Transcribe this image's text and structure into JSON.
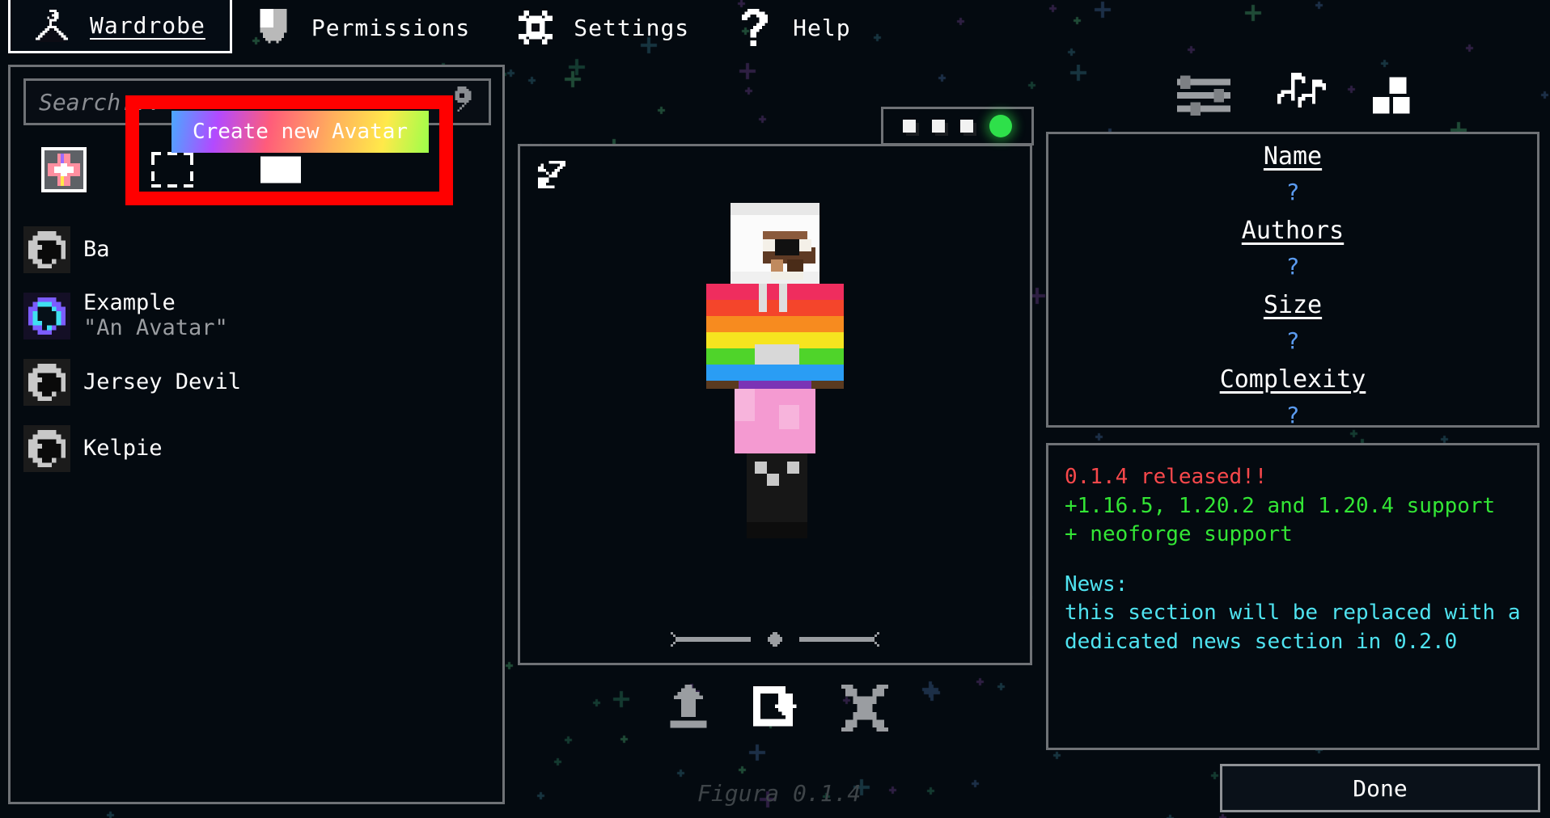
{
  "tabs": [
    {
      "id": "wardrobe",
      "label": "Wardrobe",
      "icon": "hanger-icon",
      "active": true
    },
    {
      "id": "permissions",
      "label": "Permissions",
      "icon": "shield-icon",
      "active": false
    },
    {
      "id": "settings",
      "label": "Settings",
      "icon": "gear-icon",
      "active": false
    },
    {
      "id": "help",
      "label": "Help",
      "icon": "question-icon",
      "active": false
    }
  ],
  "search": {
    "placeholder": "Search...",
    "value": "",
    "icon": "search-icon"
  },
  "create_row": {
    "new_avatar_icon": "plus-icon",
    "open_folder_icon": "dashed-folder-icon",
    "reload_icon": "white-square-icon"
  },
  "tooltip": {
    "text": "Create new Avatar"
  },
  "avatars": [
    {
      "name": "Ba",
      "desc": "",
      "thumb": "grey-ring-icon"
    },
    {
      "name": "Example",
      "desc": "\"An Avatar\"",
      "thumb": "cyan-ring-icon"
    },
    {
      "name": "Jersey Devil",
      "desc": "",
      "thumb": "grey-ring-icon"
    },
    {
      "name": "Kelpie",
      "desc": "",
      "thumb": "grey-ring-icon"
    }
  ],
  "model_viewport": {
    "expand_icon": "expand-arrows-icon",
    "rotate_slider_icon": "rotate-slider-icon"
  },
  "status_dots": {
    "dots": [
      "white",
      "white",
      "white",
      "green"
    ],
    "green_color": "#2ee04a"
  },
  "right_icons": [
    {
      "id": "sliders",
      "icon": "sliders-icon"
    },
    {
      "id": "sounds",
      "icon": "music-notes-icon"
    },
    {
      "id": "textures",
      "icon": "blocks-icon"
    }
  ],
  "metadata": [
    {
      "key": "Name",
      "value": "?"
    },
    {
      "key": "Authors",
      "value": "?"
    },
    {
      "key": "Size",
      "value": "?"
    },
    {
      "key": "Complexity",
      "value": "?"
    }
  ],
  "news": {
    "lines": [
      {
        "text": "0.1.4 released!!",
        "color": "red"
      },
      {
        "text": "+1.16.5, 1.20.2 and 1.20.4 support",
        "color": "green"
      },
      {
        "text": "+ neoforge support",
        "color": "green"
      },
      {
        "text": "",
        "color": "gap"
      },
      {
        "text": "News:",
        "color": "cyan"
      },
      {
        "text": "this section will be replaced with a",
        "color": "cyan"
      },
      {
        "text": "dedicated news section in 0.2.0",
        "color": "cyan"
      }
    ]
  },
  "actions": [
    {
      "id": "upload",
      "icon": "upload-icon"
    },
    {
      "id": "reload",
      "icon": "reload-icon"
    },
    {
      "id": "delete",
      "icon": "close-x-icon"
    }
  ],
  "footer": {
    "version": "Figura 0.1.4",
    "done_label": "Done"
  },
  "colors": {
    "background": "#040a10",
    "panel_border": "#6f7276",
    "accent_blue": "#5b9bf0",
    "highlight_red": "#ff0000",
    "news_red": "#f8484b",
    "news_green": "#33e635",
    "news_cyan": "#4fe3f0"
  }
}
